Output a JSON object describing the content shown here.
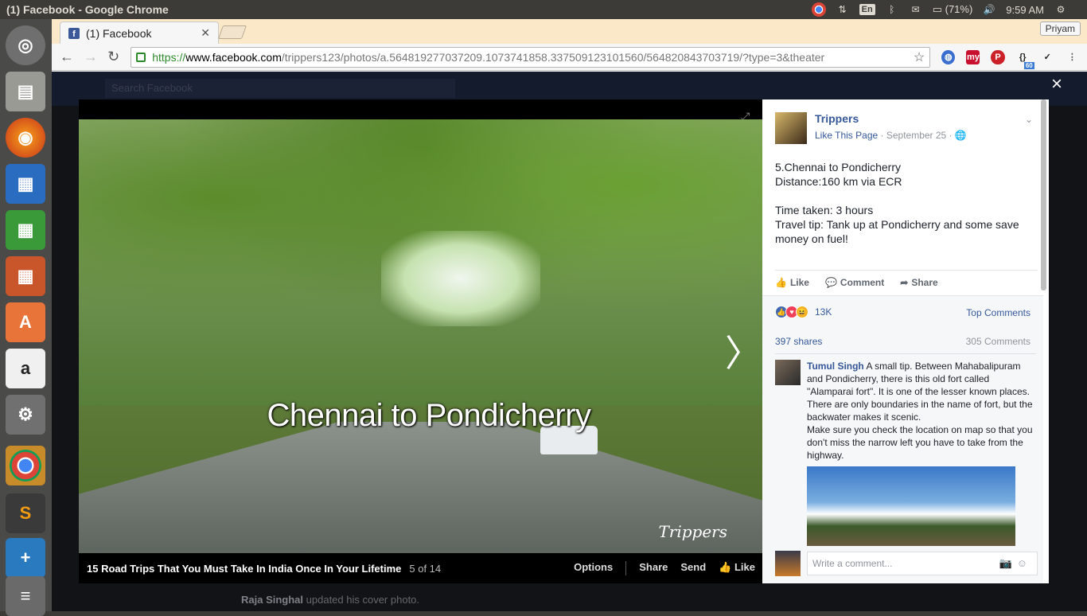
{
  "os": {
    "window_title": "(1) Facebook - Google Chrome",
    "battery": "(71%)",
    "keyboard": "En",
    "clock": "9:59 AM"
  },
  "browser": {
    "tab_title": "(1) Facebook",
    "profile": "Priyam",
    "url": {
      "scheme": "https://",
      "host": "www.facebook.com",
      "path": "/trippers123/photos/a.564819277037209.1073741858.337509123101560/564820843703719/?type=3&theater"
    },
    "ext_badge": "60"
  },
  "facebook": {
    "search_placeholder": "Search Facebook",
    "close": "×"
  },
  "photo": {
    "overlay_text": "Chennai to Pondicherry",
    "watermark": "Trippers",
    "album_title": "15 Road Trips That You Must Take In India Once In Your Lifetime",
    "counter": "5 of 14",
    "actions": {
      "options": "Options",
      "share": "Share",
      "send": "Send",
      "like": "Like"
    }
  },
  "post": {
    "page_name": "Trippers",
    "like_page": "Like This Page",
    "date": "· September 25 ·",
    "text": "5.Chennai to Pondicherry\nDistance:160 km via ECR\n\nTime taken: 3 hours\nTravel tip: Tank up at Pondicherry and some save money on fuel!",
    "like": "Like",
    "comment": "Comment",
    "share": "Share",
    "reactions_count": "13K",
    "top_comments": "Top Comments",
    "shares": "397 shares",
    "comments_count": "305 Comments"
  },
  "comment": {
    "author": "Tumul Singh",
    "text": " A small tip. Between Mahabalipuram and Pondicherry, there is this old fort called \"Alamparai fort\". It is one of the lesser known places. There are only boundaries in the name of fort, but the backwater makes it scenic.\nMake sure you check the location on map so that you don't miss the narrow left you have to take from the highway.",
    "write_placeholder": "Write a comment..."
  },
  "feed_bg": {
    "name": "Raja Singhal",
    "text": " updated his cover photo."
  }
}
